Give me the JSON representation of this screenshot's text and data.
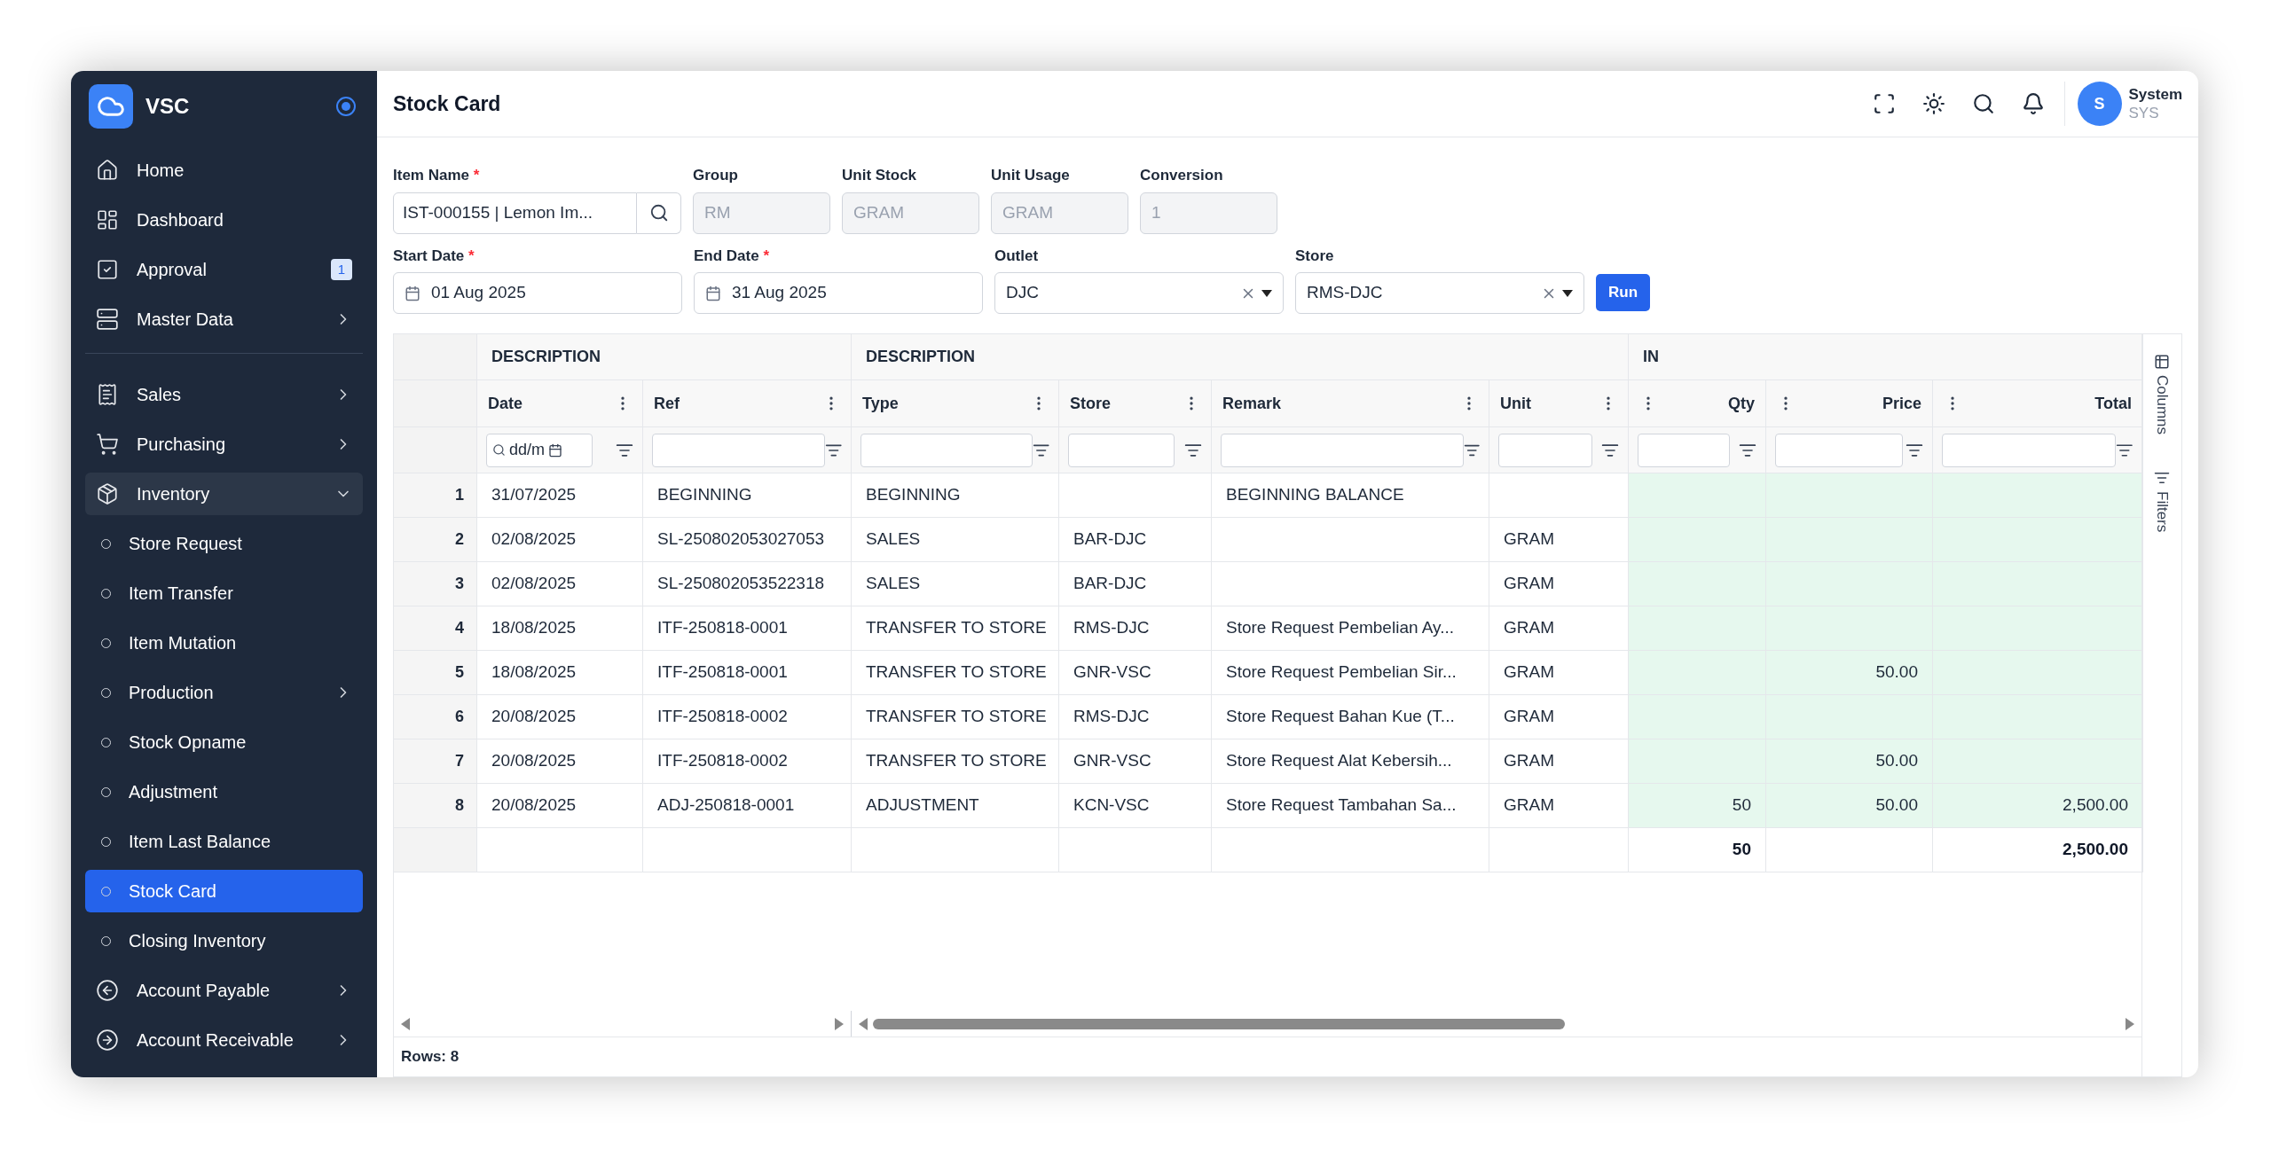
{
  "sidebar": {
    "brand": "VSC",
    "sections": [
      {
        "items": [
          {
            "label": "Home",
            "kind": "link",
            "selected": false
          },
          {
            "label": "Dashboard",
            "kind": "link",
            "selected": false
          },
          {
            "label": "Approval",
            "kind": "link",
            "selected": false,
            "badge": "1"
          },
          {
            "label": "Master Data",
            "kind": "menu",
            "selected": false,
            "expanded": false
          }
        ]
      },
      {
        "items": [
          {
            "label": "Sales",
            "kind": "menu",
            "selected": false,
            "expanded": false
          },
          {
            "label": "Purchasing",
            "kind": "menu",
            "selected": false,
            "expanded": false
          },
          {
            "label": "Inventory",
            "kind": "menu",
            "selected": false,
            "expanded": true,
            "children": [
              {
                "label": "Store Request",
                "kind": "link",
                "selected": false
              },
              {
                "label": "Item Transfer",
                "kind": "link",
                "selected": false
              },
              {
                "label": "Item Mutation",
                "kind": "link",
                "selected": false
              },
              {
                "label": "Production",
                "kind": "menu",
                "selected": false,
                "expanded": false
              },
              {
                "label": "Stock Opname",
                "kind": "link",
                "selected": false
              },
              {
                "label": "Adjustment",
                "kind": "link",
                "selected": false
              },
              {
                "label": "Item Last Balance",
                "kind": "link",
                "selected": false
              },
              {
                "label": "Stock Card",
                "kind": "link",
                "selected": true
              },
              {
                "label": "Closing Inventory",
                "kind": "link",
                "selected": false
              }
            ]
          },
          {
            "label": "Account Payable",
            "kind": "menu",
            "selected": false,
            "expanded": false
          },
          {
            "label": "Account Receivable",
            "kind": "menu",
            "selected": false,
            "expanded": false
          }
        ]
      }
    ]
  },
  "header": {
    "title": "Stock Card",
    "user": {
      "initial": "S",
      "name": "System",
      "code": "SYS"
    }
  },
  "item_fields": [
    {
      "label": "Item Name",
      "required_mark": "*",
      "kind": "search",
      "value": "IST-000155 | Lemon Im...",
      "disabled": false
    },
    {
      "label": "Group",
      "kind": "text",
      "value": "RM",
      "disabled": true
    },
    {
      "label": "Unit Stock",
      "kind": "text",
      "value": "GRAM",
      "disabled": true
    },
    {
      "label": "Unit Usage",
      "kind": "text",
      "value": "GRAM",
      "disabled": true
    },
    {
      "label": "Conversion",
      "kind": "text",
      "value": "1",
      "disabled": true
    }
  ],
  "filter_fields": [
    {
      "label": "Start Date",
      "required_mark": "*",
      "kind": "date",
      "value": "01 Aug 2025",
      "disabled": false
    },
    {
      "label": "End Date",
      "required_mark": "*",
      "kind": "date",
      "value": "31 Aug 2025",
      "disabled": false
    },
    {
      "label": "Outlet",
      "kind": "select",
      "value": "DJC",
      "disabled": false
    },
    {
      "label": "Store",
      "kind": "select",
      "value": "RMS-DJC",
      "disabled": false
    }
  ],
  "run_button": "Run",
  "table": {
    "groups": [
      {
        "label": "DESCRIPTION",
        "kind": "plain",
        "columns": [
          {
            "label": "Date",
            "placeholder": "dd/m"
          },
          {
            "label": "Ref"
          }
        ]
      },
      {
        "label": "DESCRIPTION",
        "kind": "plain",
        "columns": [
          {
            "label": "Type"
          },
          {
            "label": "Store"
          },
          {
            "label": "Remark"
          },
          {
            "label": "Unit"
          }
        ]
      },
      {
        "label": "IN",
        "kind": "in",
        "columns": [
          {
            "label": "Qty"
          },
          {
            "label": "Price"
          },
          {
            "label": "Total"
          }
        ]
      }
    ],
    "rows": [
      {
        "num": "1",
        "date": "31/07/2025",
        "ref": "BEGINNING",
        "type": "BEGINNING",
        "remark": "BEGINNING BALANCE"
      },
      {
        "num": "2",
        "date": "02/08/2025",
        "ref": "SL-250802053027053",
        "type": "SALES",
        "store": "BAR-DJC",
        "unit": "GRAM"
      },
      {
        "num": "3",
        "date": "02/08/2025",
        "ref": "SL-250802053522318",
        "type": "SALES",
        "store": "BAR-DJC",
        "unit": "GRAM"
      },
      {
        "num": "4",
        "date": "18/08/2025",
        "ref": "ITF-250818-0001",
        "type": "TRANSFER TO STORE",
        "store": "RMS-DJC",
        "remark": "Store Request Pembelian Ay...",
        "unit": "GRAM"
      },
      {
        "num": "5",
        "date": "18/08/2025",
        "ref": "ITF-250818-0001",
        "type": "TRANSFER TO STORE",
        "store": "GNR-VSC",
        "remark": "Store Request Pembelian Sir...",
        "unit": "GRAM",
        "price": "50.00"
      },
      {
        "num": "6",
        "date": "20/08/2025",
        "ref": "ITF-250818-0002",
        "type": "TRANSFER TO STORE",
        "store": "RMS-DJC",
        "remark": "Store Request Bahan Kue (T...",
        "unit": "GRAM"
      },
      {
        "num": "7",
        "date": "20/08/2025",
        "ref": "ITF-250818-0002",
        "type": "TRANSFER TO STORE",
        "store": "GNR-VSC",
        "remark": "Store Request Alat Kebersih...",
        "unit": "GRAM",
        "price": "50.00"
      },
      {
        "num": "8",
        "date": "20/08/2025",
        "ref": "ADJ-250818-0001",
        "type": "ADJUSTMENT",
        "store": "KCN-VSC",
        "remark": "Store Request Tambahan Sa...",
        "unit": "GRAM",
        "qty": "50",
        "price": "50.00",
        "total": "2,500.00"
      }
    ],
    "totals": {
      "qty": "50",
      "total": "2,500.00"
    },
    "side_panel": [
      "Columns",
      "Filters"
    ]
  },
  "status_bar": "Rows: 8"
}
